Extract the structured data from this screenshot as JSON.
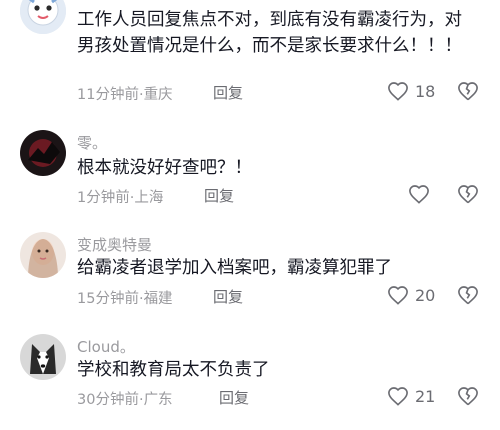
{
  "comments": [
    {
      "username": "",
      "text": "工作人员回复焦点不对，到底有没有霸凌行为，对男孩处置情况是什么，而不是家长要求什么！！！",
      "time": "11分钟前",
      "location": "重庆",
      "reply_label": "回复",
      "likes": "18"
    },
    {
      "username": "零。",
      "text": "根本就没好好查吧？！",
      "time": "1分钟前",
      "location": "上海",
      "reply_label": "回复",
      "likes": ""
    },
    {
      "username": "变成奥特曼",
      "text": "给霸凌者退学加入档案吧，霸凌算犯罪了",
      "time": "15分钟前",
      "location": "福建",
      "reply_label": "回复",
      "likes": "20"
    },
    {
      "username": "Cloud。",
      "text": "学校和教育局太不负责了",
      "time": "30分钟前",
      "location": "广东",
      "reply_label": "回复",
      "likes": "21"
    }
  ],
  "meta_separator": "·",
  "icons": {
    "like": "heart-outline-icon",
    "dislike": "broken-heart-icon"
  },
  "colors": {
    "text": "#161823",
    "secondary": "#9a9a9e",
    "action": "#6b6c72"
  }
}
